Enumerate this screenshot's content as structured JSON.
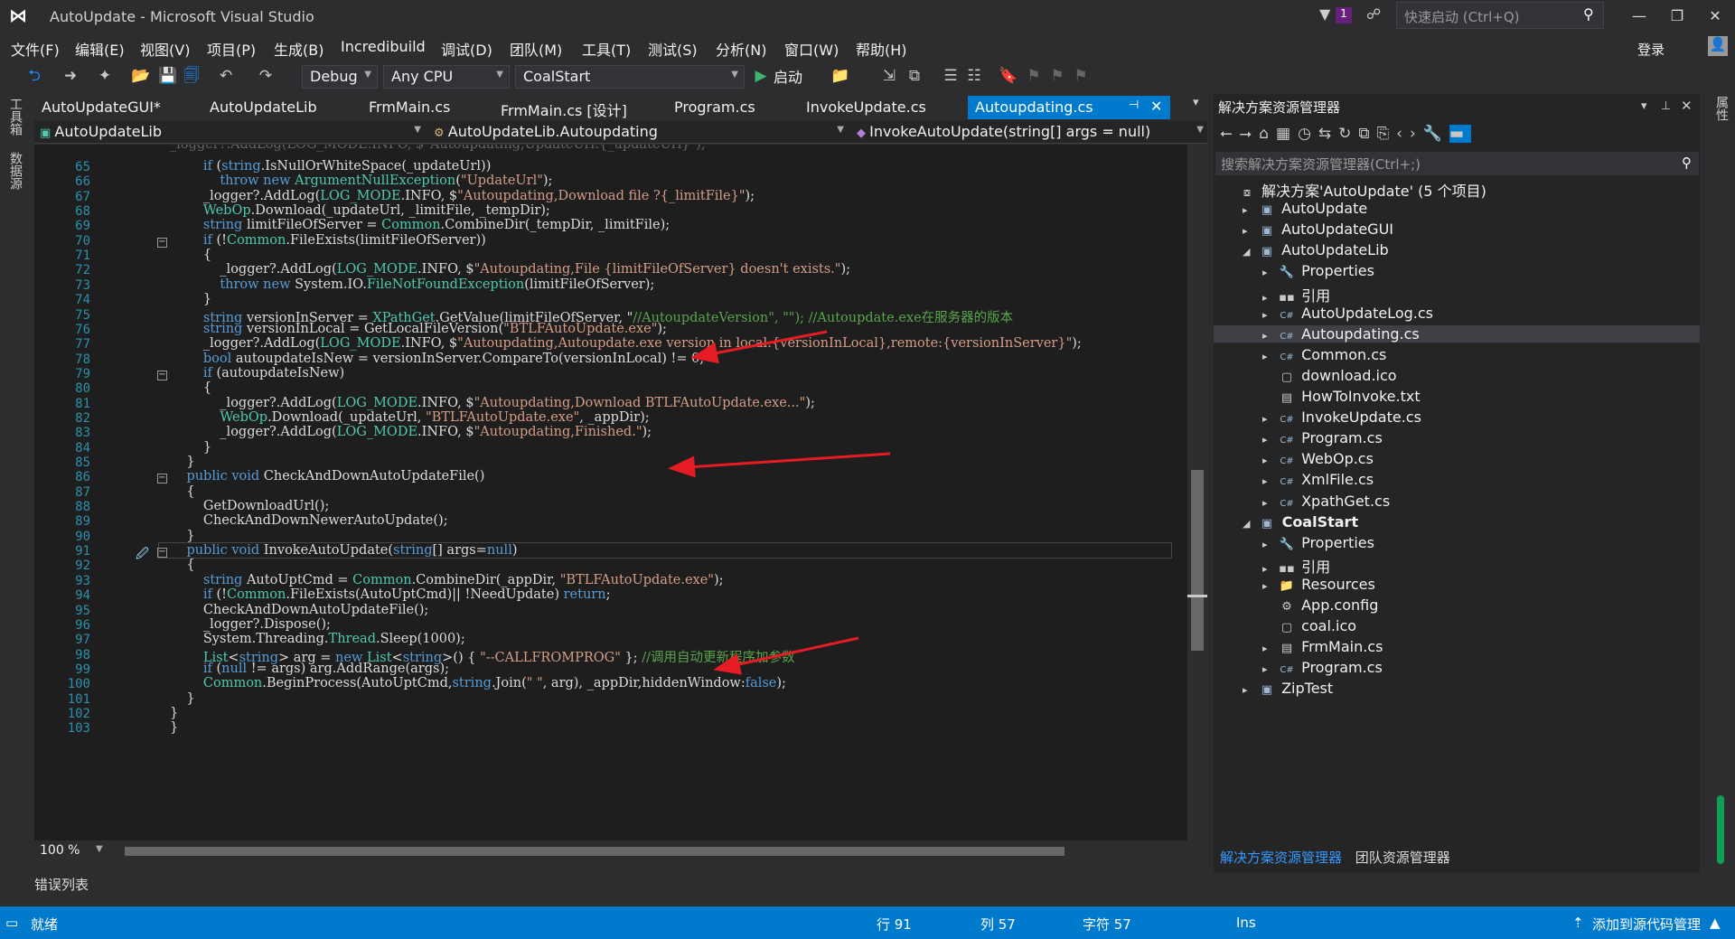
{
  "window": {
    "title": "AutoUpdate - Microsoft Visual Studio",
    "notify_count": "1",
    "quick_launch": "快速启动 (Ctrl+Q)",
    "login": "登录"
  },
  "menu": [
    "文件(F)",
    "编辑(E)",
    "视图(V)",
    "项目(P)",
    "生成(B)",
    "Incredibuild",
    "调试(D)",
    "团队(M)",
    "工具(T)",
    "测试(S)",
    "分析(N)",
    "窗口(W)",
    "帮助(H)"
  ],
  "toolbar": {
    "config": "Debug",
    "platform": "Any CPU",
    "startup": "CoalStart",
    "start": "启动"
  },
  "left_strip": [
    "工具箱",
    "数据源"
  ],
  "tabs": [
    {
      "label": "AutoUpdateGUI*"
    },
    {
      "label": "AutoUpdateLib"
    },
    {
      "label": "FrmMain.cs"
    },
    {
      "label": "FrmMain.cs [设计]"
    },
    {
      "label": "Program.cs"
    },
    {
      "label": "InvokeUpdate.cs"
    },
    {
      "label": "Autoupdating.cs",
      "active": true
    }
  ],
  "nav": {
    "project": "AutoUpdateLib",
    "class": "AutoUpdateLib.Autoupdating",
    "member": "InvokeAutoUpdate(string[] args = null)"
  },
  "editor": {
    "first_line_partial": "_logger?.AddLog(LOG_MODE.INFO, $\"Autoupdating,UpdateUrl:{_updateUrl}\");",
    "lines": [
      {
        "n": "65",
        "t": "        if (string.IsNullOrWhiteSpace(_updateUrl))"
      },
      {
        "n": "66",
        "t": "            throw new ArgumentNullException(\"UpdateUrl\");"
      },
      {
        "n": "67",
        "t": "        _logger?.AddLog(LOG_MODE.INFO, $\"Autoupdating,Download file ?{_limitFile}\");"
      },
      {
        "n": "68",
        "t": "        WebOp.Download(_updateUrl, _limitFile, _tempDir);"
      },
      {
        "n": "69",
        "t": "        string limitFileOfServer = Common.CombineDir(_tempDir, _limitFile);"
      },
      {
        "n": "70",
        "t": "        if (!Common.FileExists(limitFileOfServer))"
      },
      {
        "n": "71",
        "t": "        {"
      },
      {
        "n": "72",
        "t": "            _logger?.AddLog(LOG_MODE.INFO, $\"Autoupdating,File {limitFileOfServer} doesn't exists.\");"
      },
      {
        "n": "73",
        "t": "            throw new System.IO.FileNotFoundException(limitFileOfServer);"
      },
      {
        "n": "74",
        "t": "        }"
      },
      {
        "n": "75",
        "t": "        string versionInServer = XPathGet.GetValue(limitFileOfServer, \"//AutoupdateVersion\", \"\"); //Autoupdate.exe在服务器的版本"
      },
      {
        "n": "76",
        "t": "        string versionInLocal = GetLocalFileVersion(\"BTLFAutoUpdate.exe\");"
      },
      {
        "n": "77",
        "t": "        _logger?.AddLog(LOG_MODE.INFO, $\"Autoupdating,Autoupdate.exe version in local:{versionInLocal},remote:{versionInServer}\");"
      },
      {
        "n": "78",
        "t": "        bool autoupdateIsNew = versionInServer.CompareTo(versionInLocal) != 0;"
      },
      {
        "n": "79",
        "t": "        if (autoupdateIsNew)"
      },
      {
        "n": "80",
        "t": "        {"
      },
      {
        "n": "81",
        "t": "            _logger?.AddLog(LOG_MODE.INFO, $\"Autoupdating,Download BTLFAutoUpdate.exe...\");"
      },
      {
        "n": "82",
        "t": "            WebOp.Download(_updateUrl, \"BTLFAutoUpdate.exe\", _appDir);"
      },
      {
        "n": "83",
        "t": "            _logger?.AddLog(LOG_MODE.INFO, $\"Autoupdating,Finished.\");"
      },
      {
        "n": "84",
        "t": "        }"
      },
      {
        "n": "85",
        "t": "    }"
      },
      {
        "n": "86",
        "t": "    public void CheckAndDownAutoUpdateFile()"
      },
      {
        "n": "87",
        "t": "    {"
      },
      {
        "n": "88",
        "t": "        GetDownloadUrl();"
      },
      {
        "n": "89",
        "t": "        CheckAndDownNewerAutoUpdate();"
      },
      {
        "n": "90",
        "t": "    }"
      },
      {
        "n": "91",
        "t": "    public void InvokeAutoUpdate(string[] args=null)"
      },
      {
        "n": "92",
        "t": "    {"
      },
      {
        "n": "93",
        "t": "        string AutoUptCmd = Common.CombineDir(_appDir, \"BTLFAutoUpdate.exe\");"
      },
      {
        "n": "94",
        "t": "        if (!Common.FileExists(AutoUptCmd)|| !NeedUpdate) return;"
      },
      {
        "n": "95",
        "t": "        CheckAndDownAutoUpdateFile();"
      },
      {
        "n": "96",
        "t": "        _logger?.Dispose();"
      },
      {
        "n": "97",
        "t": "        System.Threading.Thread.Sleep(1000);"
      },
      {
        "n": "98",
        "t": "        List<string> arg = new List<string>() { \"--CALLFROMPROG\" }; //调用自动更新程序加参数"
      },
      {
        "n": "99",
        "t": "        if (null != args) arg.AddRange(args);"
      },
      {
        "n": "100",
        "t": "        Common.BeginProcess(AutoUptCmd,string.Join(\" \", arg), _appDir,hiddenWindow:false);"
      },
      {
        "n": "101",
        "t": "    }"
      },
      {
        "n": "102",
        "t": "}"
      },
      {
        "n": "103",
        "t": "}"
      }
    ],
    "zoom": "100 %"
  },
  "error_list": "错误列表",
  "solution": {
    "title": "解决方案资源管理器",
    "search": "搜索解决方案资源管理器(Ctrl+;)",
    "items": [
      {
        "label": "解决方案'AutoUpdate' (5 个项目)",
        "icon": "solution-icon"
      },
      {
        "label": "AutoUpdate",
        "icon": "csproj-icon"
      },
      {
        "label": "AutoUpdateGUI",
        "icon": "csproj-icon"
      },
      {
        "label": "AutoUpdateLib",
        "icon": "csproj-icon"
      },
      {
        "label": "Properties",
        "icon": "wrench-icon"
      },
      {
        "label": "引用",
        "icon": "references-icon"
      },
      {
        "label": "AutoUpdateLog.cs",
        "icon": "cs-file-icon"
      },
      {
        "label": "Autoupdating.cs",
        "icon": "cs-file-icon"
      },
      {
        "label": "Common.cs",
        "icon": "cs-file-icon"
      },
      {
        "label": "download.ico",
        "icon": "ico-file-icon"
      },
      {
        "label": "HowToInvoke.txt",
        "icon": "txt-file-icon"
      },
      {
        "label": "InvokeUpdate.cs",
        "icon": "cs-file-icon"
      },
      {
        "label": "Program.cs",
        "icon": "cs-file-icon"
      },
      {
        "label": "WebOp.cs",
        "icon": "cs-file-icon"
      },
      {
        "label": "XmlFile.cs",
        "icon": "cs-file-icon"
      },
      {
        "label": "XpathGet.cs",
        "icon": "cs-file-icon"
      },
      {
        "label": "CoalStart",
        "icon": "csproj-icon"
      },
      {
        "label": "Properties",
        "icon": "wrench-icon"
      },
      {
        "label": "引用",
        "icon": "references-icon"
      },
      {
        "label": "Resources",
        "icon": "folder-icon"
      },
      {
        "label": "App.config",
        "icon": "config-file-icon"
      },
      {
        "label": "coal.ico",
        "icon": "ico-file-icon"
      },
      {
        "label": "FrmMain.cs",
        "icon": "form-icon"
      },
      {
        "label": "Program.cs",
        "icon": "cs-file-icon"
      },
      {
        "label": "ZipTest",
        "icon": "csproj-icon"
      }
    ],
    "bottom_tabs": [
      "解决方案资源管理器",
      "团队资源管理器"
    ]
  },
  "right_strip": "属性",
  "status": {
    "ready": "就绪",
    "row": "行 91",
    "col": "列 57",
    "char": "字符 57",
    "ins": "Ins",
    "source": "添加到源代码管理"
  }
}
